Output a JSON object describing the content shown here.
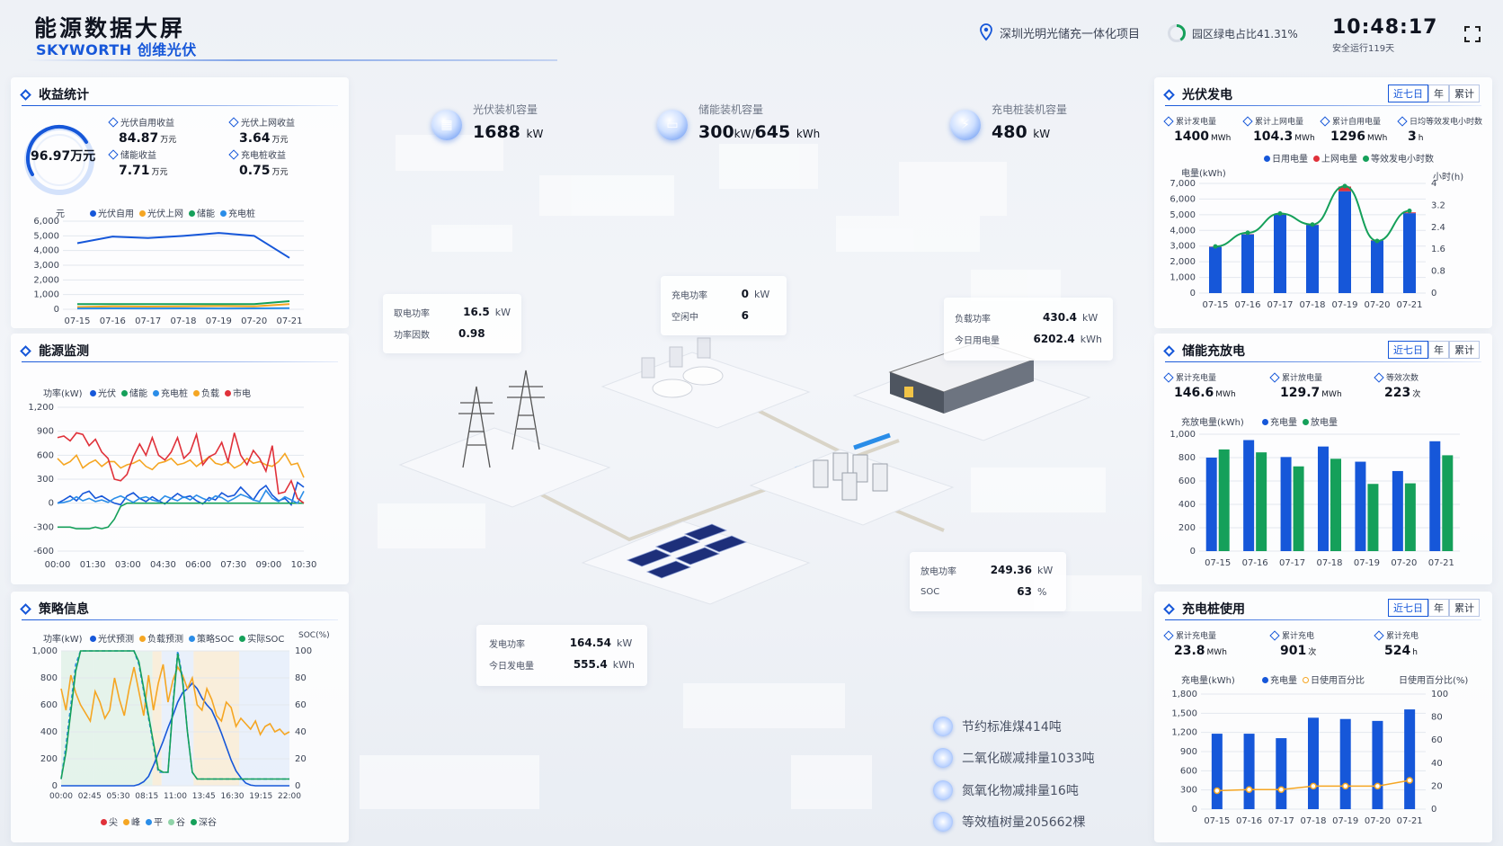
{
  "header": {
    "title": "能源数据大屏",
    "brand": "SKYWORTH 创维光伏",
    "project": "深圳光明光储充一体化项目",
    "green_ratio": "园区绿电占比41.31%",
    "green_ratio_value": 0.4131,
    "time": "10:48:17",
    "safe_run": "安全运行119天"
  },
  "revenue": {
    "title": "收益统计",
    "total": "96.97万元",
    "items": [
      {
        "label": "光伏自用收益",
        "value": "84.87",
        "unit": "万元"
      },
      {
        "label": "光伏上网收益",
        "value": "3.64",
        "unit": "万元"
      },
      {
        "label": "储能收益",
        "value": "7.71",
        "unit": "万元"
      },
      {
        "label": "充电桩收益",
        "value": "0.75",
        "unit": "万元"
      }
    ],
    "unit_label": "元",
    "legend": [
      "光伏自用",
      "光伏上网",
      "储能",
      "充电桩"
    ]
  },
  "monitor": {
    "title": "能源监测",
    "unit_label": "功率(kW)",
    "legend": [
      "光伏",
      "储能",
      "充电桩",
      "负载",
      "市电"
    ]
  },
  "strategy": {
    "title": "策略信息",
    "unit_left": "功率(kW)",
    "unit_right": "SOC(%)",
    "legend": [
      "光伏预测",
      "负载预测",
      "策略SOC",
      "实际SOC"
    ],
    "period_legend": [
      "尖",
      "峰",
      "平",
      "谷",
      "深谷"
    ]
  },
  "capacity": [
    {
      "label": "光伏装机容量",
      "value": "1688",
      "unit": "kW"
    },
    {
      "label": "储能装机容量",
      "value": "300",
      "unit": "kW/",
      "value2": "645",
      "unit2": "kWh"
    },
    {
      "label": "充电桩装机容量",
      "value": "480",
      "unit": "kW"
    }
  ],
  "grid_box": {
    "rows": [
      {
        "k": "取电功率",
        "v": "16.5",
        "u": "kW"
      },
      {
        "k": "功率因数",
        "v": "0.98",
        "u": ""
      }
    ]
  },
  "charger_box": {
    "rows": [
      {
        "k": "充电功率",
        "v": "0",
        "u": "kW"
      },
      {
        "k": "空闲中",
        "v": "6",
        "u": ""
      }
    ]
  },
  "load_box": {
    "rows": [
      {
        "k": "负载功率",
        "v": "430.4",
        "u": "kW"
      },
      {
        "k": "今日用电量",
        "v": "6202.4",
        "u": "kWh"
      }
    ]
  },
  "storage_box": {
    "rows": [
      {
        "k": "放电功率",
        "v": "249.36",
        "u": "kW"
      },
      {
        "k": "SOC",
        "v": "63",
        "u": "%"
      }
    ]
  },
  "pv_box": {
    "rows": [
      {
        "k": "发电功率",
        "v": "164.54",
        "u": "kW"
      },
      {
        "k": "今日发电量",
        "v": "555.4",
        "u": "kWh"
      }
    ]
  },
  "env": [
    "节约标准煤414吨",
    "二氧化碳减排量1033吨",
    "氮氧化物减排量16吨",
    "等效植树量205662棵"
  ],
  "pv_panel": {
    "title": "光伏发电",
    "tabs": [
      "近七日",
      "年",
      "累计"
    ],
    "kpis": [
      {
        "label": "累计发电量",
        "value": "1400",
        "unit": "MWh"
      },
      {
        "label": "累计上网电量",
        "value": "104.3",
        "unit": "MWh"
      },
      {
        "label": "累计自用电量",
        "value": "1296",
        "unit": "MWh"
      },
      {
        "label": "日均等效发电小时数",
        "value": "3",
        "unit": "h"
      }
    ],
    "legend": [
      "日用电量",
      "上网电量",
      "等效发电小时数"
    ],
    "unit_left": "电量(kWh)",
    "unit_right": "小时(h)"
  },
  "storage_panel": {
    "title": "储能充放电",
    "tabs": [
      "近七日",
      "年",
      "累计"
    ],
    "kpis": [
      {
        "label": "累计充电量",
        "value": "146.6",
        "unit": "MWh"
      },
      {
        "label": "累计放电量",
        "value": "129.7",
        "unit": "MWh"
      },
      {
        "label": "等效次数",
        "value": "223",
        "unit": "次"
      }
    ],
    "unit_left": "充放电量(kWh)",
    "legend": [
      "充电量",
      "放电量"
    ]
  },
  "charging_panel": {
    "title": "充电桩使用",
    "tabs": [
      "近七日",
      "年",
      "累计"
    ],
    "kpis": [
      {
        "label": "累计充电量",
        "value": "23.8",
        "unit": "MWh"
      },
      {
        "label": "累计充电",
        "value": "901",
        "unit": "次"
      },
      {
        "label": "累计充电",
        "value": "524",
        "unit": "h"
      }
    ],
    "unit_left": "充电量(kWh)",
    "unit_right": "日使用百分比(%)",
    "legend": [
      "充电量",
      "日使用百分比"
    ]
  },
  "colors": {
    "accent": "#1657d9",
    "green": "#15a05a",
    "orange": "#f5a623",
    "red": "#e0313a",
    "lightblue": "#2a8de8"
  },
  "chart_data": [
    {
      "type": "line",
      "id": "revenue",
      "categories": [
        "07-15",
        "07-16",
        "07-17",
        "07-18",
        "07-19",
        "07-20",
        "07-21"
      ],
      "ylim": [
        0,
        6000
      ],
      "yticks": [
        0,
        1000,
        2000,
        3000,
        4000,
        5000,
        6000
      ],
      "ytick_labels": [
        "0",
        "1,000",
        "2,000",
        "3,000",
        "4,000",
        "5,000",
        "6,000"
      ],
      "series": [
        {
          "name": "光伏自用",
          "color": "#1657d9",
          "values": [
            4500,
            4950,
            4850,
            5000,
            5200,
            5000,
            3500
          ]
        },
        {
          "name": "光伏上网",
          "color": "#f5a623",
          "values": [
            150,
            200,
            180,
            200,
            220,
            200,
            350
          ]
        },
        {
          "name": "储能",
          "color": "#15a05a",
          "values": [
            350,
            350,
            350,
            350,
            350,
            350,
            550
          ]
        },
        {
          "name": "充电桩",
          "color": "#2a8de8",
          "values": [
            50,
            60,
            50,
            60,
            50,
            60,
            80
          ]
        }
      ]
    },
    {
      "type": "line",
      "id": "monitor",
      "xticks": [
        "00:00",
        "01:30",
        "03:00",
        "04:30",
        "06:00",
        "07:30",
        "09:00",
        "10:30"
      ],
      "ylim": [
        -600,
        1200
      ],
      "yticks": [
        -600,
        -300,
        0,
        300,
        600,
        900,
        1200
      ],
      "ytick_labels": [
        "-600",
        "-300",
        "0",
        "300",
        "600",
        "900",
        "1,200"
      ],
      "series": [
        {
          "name": "光伏",
          "color": "#1657d9",
          "values": [
            0,
            40,
            90,
            30,
            120,
            150,
            60,
            90,
            40,
            0,
            -20,
            90,
            130,
            60,
            20,
            80,
            30,
            -10,
            60,
            120,
            70,
            90,
            30,
            -10,
            70,
            40,
            130,
            80,
            100,
            200,
            120,
            40,
            160,
            220,
            100,
            30,
            60,
            -20,
            260,
            200
          ]
        },
        {
          "name": "储能",
          "color": "#15a05a",
          "values": [
            -300,
            -300,
            -300,
            -320,
            -320,
            -320,
            -300,
            -320,
            -300,
            -200,
            -40,
            0,
            0,
            0,
            0,
            0,
            0,
            0,
            0,
            0,
            0,
            0,
            0,
            0,
            0,
            0,
            0,
            0,
            0,
            0,
            0,
            0,
            0,
            0,
            0,
            0,
            0,
            0,
            0,
            0
          ]
        },
        {
          "name": "充电桩",
          "color": "#2a8de8",
          "values": [
            0,
            10,
            30,
            80,
            30,
            60,
            20,
            40,
            10,
            60,
            90,
            50,
            10,
            60,
            80,
            40,
            20,
            90,
            60,
            30,
            80,
            40,
            100,
            60,
            30,
            90,
            70,
            20,
            60,
            110,
            80,
            40,
            20,
            160,
            60,
            20,
            80,
            40,
            0,
            150
          ]
        },
        {
          "name": "负载",
          "color": "#f5a623",
          "values": [
            560,
            480,
            520,
            600,
            440,
            500,
            540,
            460,
            520,
            520,
            440,
            480,
            500,
            540,
            460,
            420,
            500,
            520,
            560,
            480,
            500,
            540,
            460,
            520,
            580,
            500,
            480,
            520,
            440,
            480,
            560,
            500,
            520,
            480,
            460,
            520,
            620,
            480,
            500,
            320
          ]
        },
        {
          "name": "市电",
          "color": "#e0313a",
          "values": [
            820,
            840,
            780,
            880,
            860,
            720,
            800,
            640,
            560,
            300,
            280,
            360,
            580,
            740,
            600,
            820,
            600,
            540,
            640,
            820,
            560,
            640,
            860,
            480,
            580,
            620,
            760,
            520,
            880,
            600,
            480,
            660,
            560,
            400,
            720,
            120,
            140,
            280,
            60,
            0
          ]
        }
      ]
    },
    {
      "type": "line",
      "id": "strategy",
      "xticks": [
        "00:00",
        "02:45",
        "05:30",
        "08:15",
        "11:00",
        "13:45",
        "16:30",
        "19:15",
        "22:00"
      ],
      "ylim": [
        0,
        1000
      ],
      "yticks": [
        0,
        200,
        400,
        600,
        800,
        1000
      ],
      "ytick_labels": [
        "0",
        "200",
        "400",
        "600",
        "800",
        "1,000"
      ],
      "y2lim": [
        0,
        100
      ],
      "y2ticks": [
        0,
        20,
        40,
        60,
        80,
        100
      ],
      "series": [
        {
          "name": "光伏预测",
          "color": "#1657d9",
          "values": [
            0,
            0,
            0,
            0,
            0,
            0,
            0,
            0,
            0,
            0,
            0,
            0,
            0,
            0,
            0,
            0,
            10,
            30,
            70,
            150,
            240,
            330,
            430,
            520,
            620,
            690,
            720,
            760,
            720,
            650,
            600,
            560,
            480,
            390,
            290,
            190,
            110,
            60,
            20,
            5,
            0,
            0,
            0,
            0,
            0,
            0,
            0,
            0
          ]
        },
        {
          "name": "负载预测",
          "color": "#f5a623",
          "values": [
            720,
            560,
            820,
            690,
            600,
            540,
            480,
            700,
            620,
            500,
            560,
            800,
            640,
            520,
            720,
            880,
            700,
            520,
            820,
            560,
            760,
            900,
            620,
            780,
            880,
            820,
            720,
            800,
            600,
            560,
            720,
            640,
            520,
            480,
            620,
            580,
            440,
            500,
            460,
            420,
            480,
            380,
            440,
            460,
            400,
            420,
            380,
            400
          ]
        },
        {
          "name": "策略SOC",
          "color": "#2a8de8",
          "values": [
            5,
            30,
            60,
            90,
            100,
            100,
            100,
            100,
            100,
            100,
            100,
            100,
            100,
            100,
            100,
            100,
            90,
            70,
            50,
            30,
            10,
            10,
            10,
            60,
            100,
            80,
            40,
            10,
            5,
            5,
            5,
            5,
            5,
            5,
            5,
            5,
            5,
            5,
            5,
            5,
            5,
            5,
            5,
            5,
            5,
            5,
            5,
            5
          ]
        },
        {
          "name": "实际SOC",
          "color": "#15a05a",
          "values": [
            5,
            25,
            55,
            85,
            100,
            100,
            100,
            100,
            100,
            100,
            100,
            100,
            100,
            100,
            100,
            100,
            92,
            72,
            52,
            32,
            12,
            10,
            10,
            58,
            98,
            78,
            40,
            10,
            5,
            5,
            5,
            5,
            5,
            5,
            5,
            5,
            5,
            5,
            5,
            5,
            5,
            5,
            5,
            5,
            5,
            5,
            5,
            5
          ]
        }
      ]
    },
    {
      "type": "bar",
      "id": "pv",
      "categories": [
        "07-15",
        "07-16",
        "07-17",
        "07-18",
        "07-19",
        "07-20",
        "07-21"
      ],
      "ylim": [
        0,
        7000
      ],
      "yticks": [
        0,
        1000,
        2000,
        3000,
        4000,
        5000,
        6000,
        7000
      ],
      "ytick_labels": [
        "0",
        "1,000",
        "2,000",
        "3,000",
        "4,000",
        "5,000",
        "6,000",
        "7,000"
      ],
      "y2lim": [
        0,
        4
      ],
      "y2ticks": [
        0,
        0.8,
        1.6,
        2.4,
        3.2,
        4
      ],
      "series": [
        {
          "name": "日用电量",
          "color": "#1657d9",
          "values": [
            2950,
            3750,
            5000,
            4350,
            6500,
            3350,
            5100
          ]
        },
        {
          "name": "上网电量",
          "color": "#e0313a",
          "values": [
            20,
            20,
            20,
            20,
            300,
            30,
            50
          ]
        },
        {
          "name": "等效发电小时数",
          "color": "#15a05a",
          "axis": "right",
          "values": [
            1.7,
            2.2,
            2.9,
            2.5,
            3.9,
            1.9,
            3.0
          ]
        }
      ]
    },
    {
      "type": "bar",
      "id": "storage",
      "categories": [
        "07-15",
        "07-16",
        "07-17",
        "07-18",
        "07-19",
        "07-20",
        "07-21"
      ],
      "ylim": [
        0,
        1000
      ],
      "yticks": [
        0,
        200,
        400,
        600,
        800,
        1000
      ],
      "ytick_labels": [
        "0",
        "200",
        "400",
        "600",
        "800",
        "1,000"
      ],
      "series": [
        {
          "name": "充电量",
          "color": "#1657d9",
          "values": [
            800,
            950,
            805,
            895,
            765,
            685,
            940
          ]
        },
        {
          "name": "放电量",
          "color": "#15a05a",
          "values": [
            870,
            845,
            725,
            790,
            575,
            580,
            820
          ]
        }
      ]
    },
    {
      "type": "bar",
      "id": "charging",
      "categories": [
        "07-15",
        "07-16",
        "07-17",
        "07-18",
        "07-19",
        "07-20",
        "07-21"
      ],
      "ylim": [
        0,
        1800
      ],
      "yticks": [
        0,
        300,
        600,
        900,
        1200,
        1500,
        1800
      ],
      "ytick_labels": [
        "0",
        "300",
        "600",
        "900",
        "1,200",
        "1,500",
        "1,800"
      ],
      "y2lim": [
        0,
        100
      ],
      "y2ticks": [
        0,
        20,
        40,
        60,
        80,
        100
      ],
      "series": [
        {
          "name": "充电量",
          "color": "#1657d9",
          "values": [
            1180,
            1180,
            1110,
            1430,
            1410,
            1380,
            1560
          ]
        },
        {
          "name": "日使用百分比",
          "color": "#f5a623",
          "axis": "right",
          "values": [
            16,
            17,
            17,
            20,
            20,
            20,
            25
          ]
        }
      ]
    }
  ]
}
